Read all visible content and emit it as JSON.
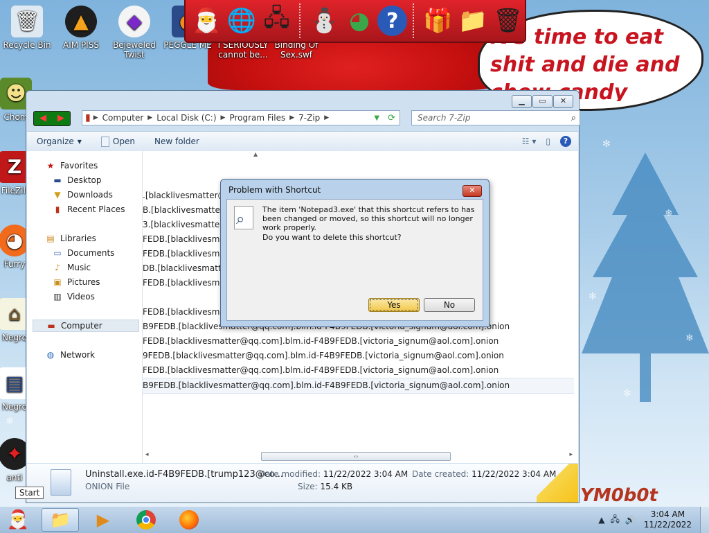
{
  "desktop": {
    "speech_text": "It's time to eat shit and die and chew candy canes",
    "watermark_text": "YM0b0t",
    "icons": [
      {
        "label": "Recycle Bin",
        "glyph": "🗑",
        "icon": "recycle-bin-icon"
      },
      {
        "label": "AIM PISS",
        "glyph": "▲",
        "icon": "aimp-icon"
      },
      {
        "label": "Bejeweled Twist",
        "glyph": "◆",
        "icon": "bejeweled-icon"
      },
      {
        "label": "PEGGLE ME",
        "glyph": "●",
        "icon": "peggle-icon"
      },
      {
        "label": "I SERIOUSLY cannot be...",
        "glyph": "🌐",
        "icon": "shortcut-icon"
      },
      {
        "label": "Binding Of Sex.swf",
        "glyph": "▶",
        "icon": "swf-icon"
      },
      {
        "label": "Chom",
        "glyph": "☻",
        "icon": "chom-icon"
      },
      {
        "label": "FileZill",
        "glyph": "Z",
        "icon": "filezilla-icon"
      },
      {
        "label": "Furry",
        "glyph": "◕",
        "icon": "furry-icon"
      },
      {
        "label": "Negro",
        "glyph": "⌂",
        "icon": "negro-icon-1"
      },
      {
        "label": "Negro",
        "glyph": "▤",
        "icon": "negro-icon-2"
      },
      {
        "label": "anti",
        "glyph": "✦",
        "icon": "anti-icon"
      }
    ]
  },
  "gadgetbar": {
    "icons": [
      "santa-computer-icon",
      "globe-icon",
      "network-icon",
      "snowman-icon",
      "color-wheel-icon",
      "help-icon",
      "gift-icon",
      "folder-icon",
      "recycle-bin-icon"
    ],
    "glyphs": [
      "🎅",
      "🌐",
      "🖧",
      "⛄",
      "◕",
      "?",
      "🎁",
      "📁",
      "🗑"
    ]
  },
  "explorer": {
    "address": [
      "Computer",
      "Local Disk (C:)",
      "Program Files",
      "7-Zip"
    ],
    "search_placeholder": "Search 7-Zip",
    "toolbar": {
      "organize": "Organize",
      "open": "Open",
      "new_folder": "New folder"
    },
    "nav": {
      "favorites": "Favorites",
      "desktop": "Desktop",
      "downloads": "Downloads",
      "recent": "Recent Places",
      "libraries": "Libraries",
      "documents": "Documents",
      "music": "Music",
      "pictures": "Pictures",
      "videos": "Videos",
      "computer": "Computer",
      "network": "Network"
    },
    "files": [
      ".[blacklivesmatter@qq",
      "B.[blacklivesmatter@c",
      "3.[blacklivesmatter@q",
      "FEDB.[blacklivesmatte",
      "FEDB.[blacklivesmatte",
      "DB.[blacklivesmatter@",
      "FEDB.[blacklivesmatte",
      "",
      "FEDB.[blacklivesmatte",
      "B9FEDB.[blacklivesmatter@qq.com].blm.id-F4B9FEDB.[victoria_signum@aol.com].onion",
      "FEDB.[blacklivesmatter@qq.com].blm.id-F4B9FEDB.[victoria_signum@aol.com].onion",
      "9FEDB.[blacklivesmatter@qq.com].blm.id-F4B9FEDB.[victoria_signum@aol.com].onion",
      "FEDB.[blacklivesmatter@qq.com].blm.id-F4B9FEDB.[victoria_signum@aol.com].onion",
      "B9FEDB.[blacklivesmatter@qq.com].blm.id-F4B9FEDB.[victoria_signum@aol.com].onion"
    ],
    "details": {
      "name": "Uninstall.exe.id-F4B9FEDB.[trump123@co...",
      "type": "ONION File",
      "modified_label": "Date modified:",
      "modified": "11/22/2022 3:04 AM",
      "size_label": "Size:",
      "size": "15.4 KB",
      "created_label": "Date created:",
      "created": "11/22/2022 3:04 AM"
    }
  },
  "dialog": {
    "title": "Problem with Shortcut",
    "message": "The item 'Notepad3.exe' that this shortcut refers to has been changed or moved, so this shortcut will no longer work properly.",
    "question": "Do you want to delete this shortcut?",
    "yes": "Yes",
    "no": "No"
  },
  "taskbar": {
    "start_tooltip": "Start",
    "time": "3:04 AM",
    "date": "11/22/2022"
  }
}
